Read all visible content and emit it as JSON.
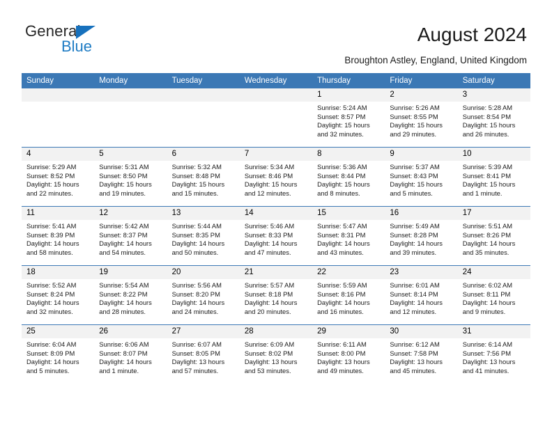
{
  "brand": {
    "word1": "General",
    "word2": "Blue",
    "accent_color": "#1771bd",
    "text_color": "#262626"
  },
  "header": {
    "title": "August 2024",
    "subtitle": "Broughton Astley, England, United Kingdom",
    "header_bg_color": "#3b78b5",
    "daynum_bg_color": "#f2f2f2"
  },
  "calendar": {
    "weekday_headers": [
      "Sunday",
      "Monday",
      "Tuesday",
      "Wednesday",
      "Thursday",
      "Friday",
      "Saturday"
    ],
    "labels": {
      "sunrise": "Sunrise:",
      "sunset": "Sunset:",
      "daylight": "Daylight:"
    },
    "weeks": [
      [
        {
          "empty": true
        },
        {
          "empty": true
        },
        {
          "empty": true
        },
        {
          "empty": true
        },
        {
          "day": "1",
          "sunrise": "Sunrise: 5:24 AM",
          "sunset": "Sunset: 8:57 PM",
          "daylight_1": "Daylight: 15 hours",
          "daylight_2": "and 32 minutes."
        },
        {
          "day": "2",
          "sunrise": "Sunrise: 5:26 AM",
          "sunset": "Sunset: 8:55 PM",
          "daylight_1": "Daylight: 15 hours",
          "daylight_2": "and 29 minutes."
        },
        {
          "day": "3",
          "sunrise": "Sunrise: 5:28 AM",
          "sunset": "Sunset: 8:54 PM",
          "daylight_1": "Daylight: 15 hours",
          "daylight_2": "and 26 minutes."
        }
      ],
      [
        {
          "day": "4",
          "sunrise": "Sunrise: 5:29 AM",
          "sunset": "Sunset: 8:52 PM",
          "daylight_1": "Daylight: 15 hours",
          "daylight_2": "and 22 minutes."
        },
        {
          "day": "5",
          "sunrise": "Sunrise: 5:31 AM",
          "sunset": "Sunset: 8:50 PM",
          "daylight_1": "Daylight: 15 hours",
          "daylight_2": "and 19 minutes."
        },
        {
          "day": "6",
          "sunrise": "Sunrise: 5:32 AM",
          "sunset": "Sunset: 8:48 PM",
          "daylight_1": "Daylight: 15 hours",
          "daylight_2": "and 15 minutes."
        },
        {
          "day": "7",
          "sunrise": "Sunrise: 5:34 AM",
          "sunset": "Sunset: 8:46 PM",
          "daylight_1": "Daylight: 15 hours",
          "daylight_2": "and 12 minutes."
        },
        {
          "day": "8",
          "sunrise": "Sunrise: 5:36 AM",
          "sunset": "Sunset: 8:44 PM",
          "daylight_1": "Daylight: 15 hours",
          "daylight_2": "and 8 minutes."
        },
        {
          "day": "9",
          "sunrise": "Sunrise: 5:37 AM",
          "sunset": "Sunset: 8:43 PM",
          "daylight_1": "Daylight: 15 hours",
          "daylight_2": "and 5 minutes."
        },
        {
          "day": "10",
          "sunrise": "Sunrise: 5:39 AM",
          "sunset": "Sunset: 8:41 PM",
          "daylight_1": "Daylight: 15 hours",
          "daylight_2": "and 1 minute."
        }
      ],
      [
        {
          "day": "11",
          "sunrise": "Sunrise: 5:41 AM",
          "sunset": "Sunset: 8:39 PM",
          "daylight_1": "Daylight: 14 hours",
          "daylight_2": "and 58 minutes."
        },
        {
          "day": "12",
          "sunrise": "Sunrise: 5:42 AM",
          "sunset": "Sunset: 8:37 PM",
          "daylight_1": "Daylight: 14 hours",
          "daylight_2": "and 54 minutes."
        },
        {
          "day": "13",
          "sunrise": "Sunrise: 5:44 AM",
          "sunset": "Sunset: 8:35 PM",
          "daylight_1": "Daylight: 14 hours",
          "daylight_2": "and 50 minutes."
        },
        {
          "day": "14",
          "sunrise": "Sunrise: 5:46 AM",
          "sunset": "Sunset: 8:33 PM",
          "daylight_1": "Daylight: 14 hours",
          "daylight_2": "and 47 minutes."
        },
        {
          "day": "15",
          "sunrise": "Sunrise: 5:47 AM",
          "sunset": "Sunset: 8:31 PM",
          "daylight_1": "Daylight: 14 hours",
          "daylight_2": "and 43 minutes."
        },
        {
          "day": "16",
          "sunrise": "Sunrise: 5:49 AM",
          "sunset": "Sunset: 8:28 PM",
          "daylight_1": "Daylight: 14 hours",
          "daylight_2": "and 39 minutes."
        },
        {
          "day": "17",
          "sunrise": "Sunrise: 5:51 AM",
          "sunset": "Sunset: 8:26 PM",
          "daylight_1": "Daylight: 14 hours",
          "daylight_2": "and 35 minutes."
        }
      ],
      [
        {
          "day": "18",
          "sunrise": "Sunrise: 5:52 AM",
          "sunset": "Sunset: 8:24 PM",
          "daylight_1": "Daylight: 14 hours",
          "daylight_2": "and 32 minutes."
        },
        {
          "day": "19",
          "sunrise": "Sunrise: 5:54 AM",
          "sunset": "Sunset: 8:22 PM",
          "daylight_1": "Daylight: 14 hours",
          "daylight_2": "and 28 minutes."
        },
        {
          "day": "20",
          "sunrise": "Sunrise: 5:56 AM",
          "sunset": "Sunset: 8:20 PM",
          "daylight_1": "Daylight: 14 hours",
          "daylight_2": "and 24 minutes."
        },
        {
          "day": "21",
          "sunrise": "Sunrise: 5:57 AM",
          "sunset": "Sunset: 8:18 PM",
          "daylight_1": "Daylight: 14 hours",
          "daylight_2": "and 20 minutes."
        },
        {
          "day": "22",
          "sunrise": "Sunrise: 5:59 AM",
          "sunset": "Sunset: 8:16 PM",
          "daylight_1": "Daylight: 14 hours",
          "daylight_2": "and 16 minutes."
        },
        {
          "day": "23",
          "sunrise": "Sunrise: 6:01 AM",
          "sunset": "Sunset: 8:14 PM",
          "daylight_1": "Daylight: 14 hours",
          "daylight_2": "and 12 minutes."
        },
        {
          "day": "24",
          "sunrise": "Sunrise: 6:02 AM",
          "sunset": "Sunset: 8:11 PM",
          "daylight_1": "Daylight: 14 hours",
          "daylight_2": "and 9 minutes."
        }
      ],
      [
        {
          "day": "25",
          "sunrise": "Sunrise: 6:04 AM",
          "sunset": "Sunset: 8:09 PM",
          "daylight_1": "Daylight: 14 hours",
          "daylight_2": "and 5 minutes."
        },
        {
          "day": "26",
          "sunrise": "Sunrise: 6:06 AM",
          "sunset": "Sunset: 8:07 PM",
          "daylight_1": "Daylight: 14 hours",
          "daylight_2": "and 1 minute."
        },
        {
          "day": "27",
          "sunrise": "Sunrise: 6:07 AM",
          "sunset": "Sunset: 8:05 PM",
          "daylight_1": "Daylight: 13 hours",
          "daylight_2": "and 57 minutes."
        },
        {
          "day": "28",
          "sunrise": "Sunrise: 6:09 AM",
          "sunset": "Sunset: 8:02 PM",
          "daylight_1": "Daylight: 13 hours",
          "daylight_2": "and 53 minutes."
        },
        {
          "day": "29",
          "sunrise": "Sunrise: 6:11 AM",
          "sunset": "Sunset: 8:00 PM",
          "daylight_1": "Daylight: 13 hours",
          "daylight_2": "and 49 minutes."
        },
        {
          "day": "30",
          "sunrise": "Sunrise: 6:12 AM",
          "sunset": "Sunset: 7:58 PM",
          "daylight_1": "Daylight: 13 hours",
          "daylight_2": "and 45 minutes."
        },
        {
          "day": "31",
          "sunrise": "Sunrise: 6:14 AM",
          "sunset": "Sunset: 7:56 PM",
          "daylight_1": "Daylight: 13 hours",
          "daylight_2": "and 41 minutes."
        }
      ]
    ]
  }
}
